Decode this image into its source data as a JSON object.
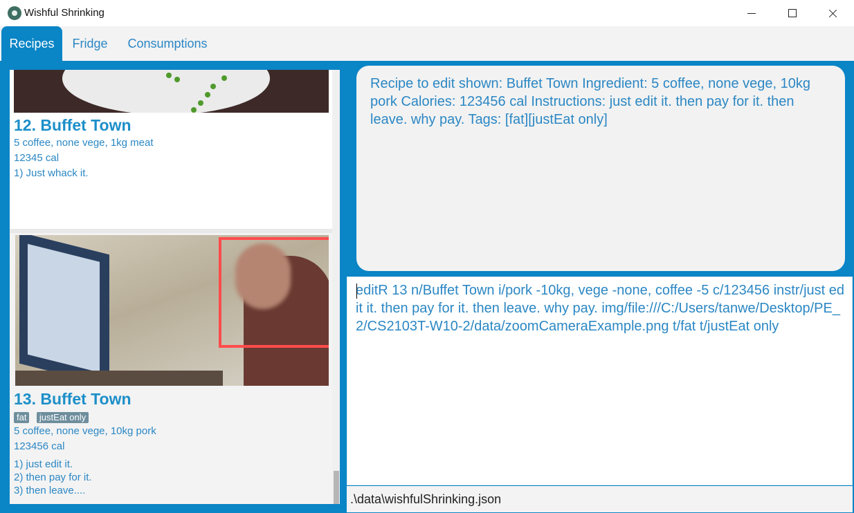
{
  "window": {
    "title": "Wishful Shrinking"
  },
  "tabs": [
    {
      "label": "Recipes",
      "active": true
    },
    {
      "label": "Fridge",
      "active": false
    },
    {
      "label": "Consumptions",
      "active": false
    }
  ],
  "recipes": [
    {
      "name": "12.  Buffet Town",
      "ingredients": "5 coffee, none vege, 1kg meat",
      "calories": "12345 cal",
      "instructions": [
        "1) Just whack it."
      ],
      "tags": []
    },
    {
      "name": "13.  Buffet Town",
      "ingredients": "5 coffee, none vege, 10kg pork",
      "calories": "123456 cal",
      "instructions": [
        "1) just edit it.",
        "2) then pay for it.",
        "3) then leave...."
      ],
      "tags": [
        "fat",
        "justEat only"
      ]
    }
  ],
  "result_display": "Recipe to edit shown: Buffet Town Ingredient: 5 coffee, none vege, 10kg pork Calories: 123456 cal Instructions: just edit it.  then pay for it.  then leave.  why pay. Tags: [fat][justEat only]",
  "command_box": {
    "value": "editR 13 n/Buffet Town i/pork -10kg, vege -none, coffee -5 c/123456 instr/just edit it. then pay for it. then leave. why pay. img/file:///C:/Users/tanwe/Desktop/PE_2/CS2103T-W10-2/data/zoomCameraExample.png t/fat t/justEat only"
  },
  "status_bar": {
    "path": ".\\data\\wishfulShrinking.json"
  },
  "colors": {
    "accent": "#0a85c6",
    "text": "#2b87c4",
    "title": "#1d8fc9",
    "tag": "#6e8e9d"
  }
}
